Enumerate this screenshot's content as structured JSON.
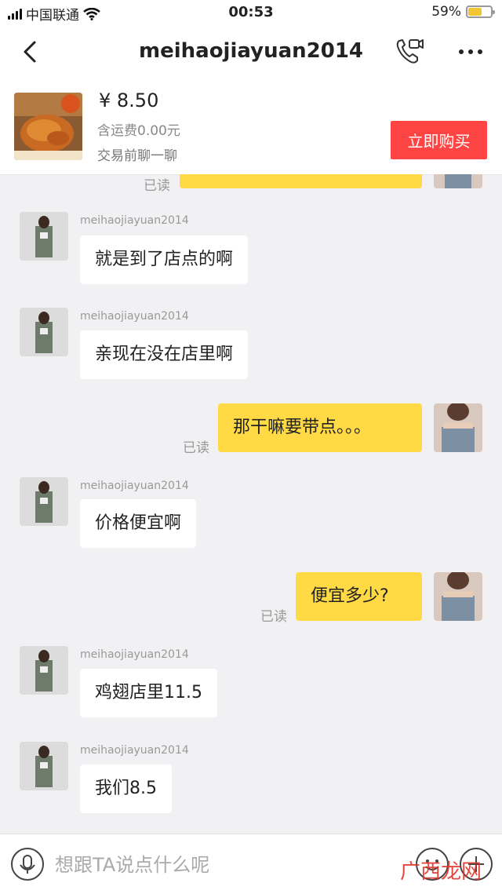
{
  "status_bar": {
    "carrier": "中国联通",
    "time": "00:53",
    "battery": "59%"
  },
  "header": {
    "title": "meihaojiayuan2014"
  },
  "product": {
    "price": "¥ 8.50",
    "shipping": "含运费0.00元",
    "note": "交易前聊一聊",
    "buy_label": "立即购买"
  },
  "chat": {
    "read_label": "已读",
    "messages": [
      {
        "sender": "meihaojiayuan2014",
        "text": "就是到了店点的啊"
      },
      {
        "sender": "meihaojiayuan2014",
        "text": "亲现在没在店里啊"
      },
      {
        "sender": "me",
        "text": "那干嘛要带点。。。"
      },
      {
        "sender": "meihaojiayuan2014",
        "text": "价格便宜啊"
      },
      {
        "sender": "me",
        "text": "便宜多少?"
      },
      {
        "sender": "meihaojiayuan2014",
        "text": "鸡翅店里11.5"
      },
      {
        "sender": "meihaojiayuan2014",
        "text": "我们8.5"
      }
    ]
  },
  "input": {
    "placeholder": "想跟TA说点什么呢"
  },
  "watermark": "广西龙网",
  "colors": {
    "accent_yellow": "#ffda44",
    "buy_red": "#ff4444"
  }
}
